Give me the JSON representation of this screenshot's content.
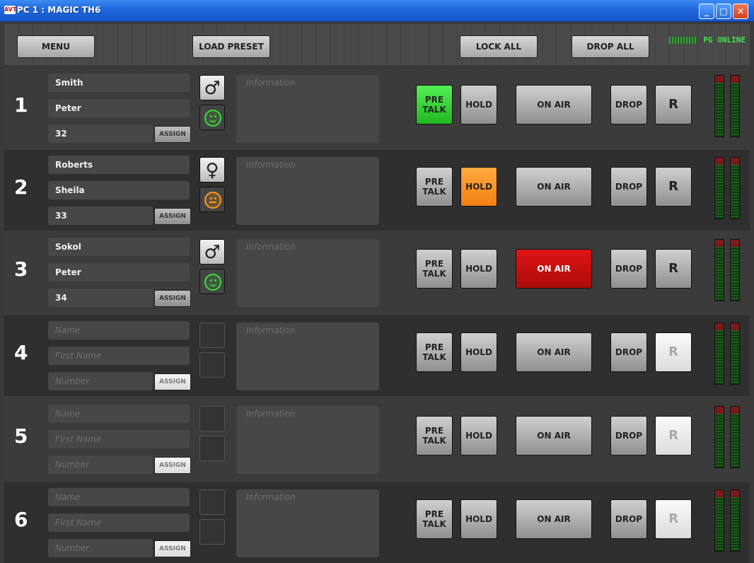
{
  "window": {
    "title": "PC 1 : MAGIC TH6",
    "logo_text": "AVT",
    "controls": {
      "minimize": "_",
      "maximize": "□",
      "close": "✕"
    }
  },
  "toolbar": {
    "menu_label": "MENU",
    "load_preset_label": "LOAD PRESET",
    "lock_all_label": "LOCK ALL",
    "drop_all_label": "DROP ALL",
    "status": "PG ONLINE"
  },
  "lines": [
    {
      "number": "1",
      "name": "Smith",
      "first_name": "Peter",
      "number_field": "32",
      "gender_icon": "male-icon",
      "gender_glyph": "♂",
      "mood": "happy-green",
      "info_placeholder": "Information",
      "state": "pretalk"
    },
    {
      "number": "2",
      "name": "Roberts",
      "first_name": "Sheila",
      "number_field": "33",
      "gender_icon": "female-icon",
      "gender_glyph": "♀",
      "mood": "neutral-orange",
      "info_placeholder": "Information",
      "state": "hold"
    },
    {
      "number": "3",
      "name": "Sokol",
      "first_name": "Peter",
      "number_field": "34",
      "gender_icon": "male-icon",
      "gender_glyph": "♂",
      "mood": "happy-green",
      "info_placeholder": "Information",
      "state": "onair"
    },
    {
      "number": "4",
      "name_placeholder": "Name",
      "first_name_placeholder": "First Name",
      "number_placeholder": "Number",
      "info_placeholder": "Information",
      "state": "idle"
    },
    {
      "number": "5",
      "name_placeholder": "Name",
      "first_name_placeholder": "First Name",
      "number_placeholder": "Number",
      "info_placeholder": "Information",
      "state": "idle"
    },
    {
      "number": "6",
      "name_placeholder": "Name",
      "first_name_placeholder": "First Name",
      "number_placeholder": "Number",
      "info_placeholder": "Information",
      "state": "idle"
    }
  ],
  "buttons": {
    "assign": "ASSIGN",
    "pretalk_line1": "PRE",
    "pretalk_line2": "TALK",
    "hold": "HOLD",
    "onair": "ON AIR",
    "drop": "DROP",
    "r": "R"
  },
  "colors": {
    "pretalk_active": "#33d633",
    "hold_active": "#f58a1a",
    "onair_active": "#c70f0f",
    "status_online": "#3fe04a"
  }
}
